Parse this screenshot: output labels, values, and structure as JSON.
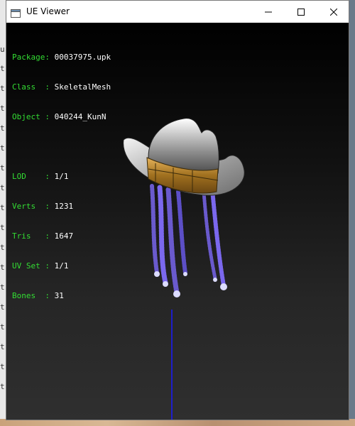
{
  "window": {
    "title": "UE Viewer"
  },
  "info": {
    "package": {
      "label": "Package:",
      "value": "00037975.upk"
    },
    "class": {
      "label": "Class  :",
      "value": "SkeletalMesh"
    },
    "object": {
      "label": "Object :",
      "value": "040244_KunN"
    },
    "lod": {
      "label": "LOD    :",
      "value": "1/1"
    },
    "verts": {
      "label": "Verts  :",
      "value": "1231"
    },
    "tris": {
      "label": "Tris   :",
      "value": "1647"
    },
    "uvset": {
      "label": "UV Set :",
      "value": "1/1"
    },
    "bones": {
      "label": "Bones  :",
      "value": "31"
    }
  },
  "colors": {
    "label": "#33dd33",
    "value": "#ffffff",
    "viewport_top": "#000000",
    "axis": "#1a1aff"
  },
  "icons": {
    "app": "window-icon",
    "minimize": "minimize-icon",
    "maximize": "maximize-icon",
    "close": "close-icon"
  }
}
